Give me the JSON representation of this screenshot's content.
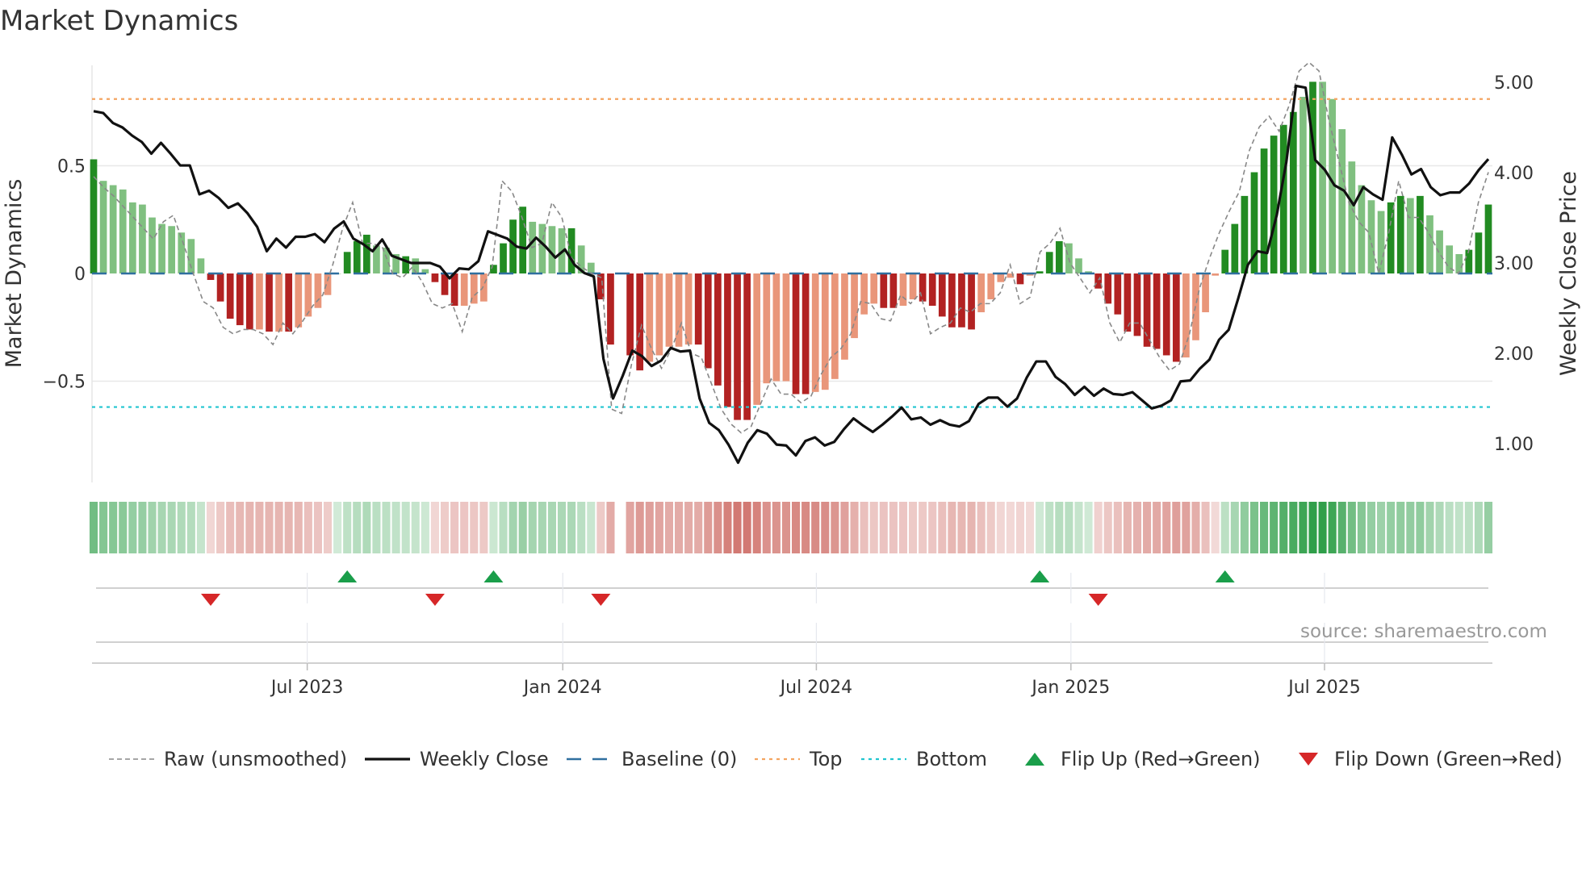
{
  "title": "Market Dynamics",
  "source": "source: sharemaestro.com",
  "colors": {
    "green_strong": "#228b22",
    "green_weak": "#80c080",
    "red_strong": "#b22222",
    "red_weak": "#e9967a",
    "close": "#111111",
    "raw": "#888888",
    "baseline": "#2f6f9f",
    "top": "#f4a460",
    "bottom": "#20c5d0",
    "flip_up": "#1a9e4a",
    "flip_down": "#d62728",
    "heat_green": "#2e9e48",
    "heat_red": "#c85a52"
  },
  "legend": [
    {
      "key": "raw",
      "label": "Raw (unsmoothed)"
    },
    {
      "key": "close",
      "label": "Weekly Close"
    },
    {
      "key": "baseline",
      "label": "Baseline (0)"
    },
    {
      "key": "top",
      "label": "Top"
    },
    {
      "key": "bottom",
      "label": "Bottom"
    },
    {
      "key": "flip_up",
      "label": "Flip Up (Red→Green)"
    },
    {
      "key": "flip_down",
      "label": "Flip Down (Green→Red)"
    }
  ],
  "chart_data": {
    "type": "bar",
    "title": "Market Dynamics",
    "ylabel": "Market Dynamics",
    "ylabel_right": "Weekly Close Price",
    "ylim": [
      -1.0,
      0.98
    ],
    "ylim_right": [
      0.35,
      5.55
    ],
    "yticks": [
      {
        "v": 0.5,
        "label": "0.5"
      },
      {
        "v": 0,
        "label": "0"
      },
      {
        "v": -0.5,
        "label": "−0.5"
      }
    ],
    "yticks_right": [
      {
        "v": 5,
        "label": "5.00"
      },
      {
        "v": 4,
        "label": "4.00"
      },
      {
        "v": 3,
        "label": "3.00"
      },
      {
        "v": 2,
        "label": "2.00"
      },
      {
        "v": 1,
        "label": "1.00"
      }
    ],
    "xticks": [
      {
        "week": 21.9,
        "label": "Jul 2023"
      },
      {
        "week": 48.1,
        "label": "Jan 2024"
      },
      {
        "week": 74.1,
        "label": "Jul 2024"
      },
      {
        "week": 100.2,
        "label": "Jan 2025"
      },
      {
        "week": 126.2,
        "label": "Jul 2025"
      }
    ],
    "top_level": 0.81,
    "bottom_level": -0.62,
    "baseline": 0,
    "values": [
      0.53,
      0.43,
      0.41,
      0.39,
      0.33,
      0.32,
      0.26,
      0.23,
      0.22,
      0.19,
      0.16,
      0.07,
      -0.03,
      -0.13,
      -0.21,
      -0.24,
      -0.26,
      -0.26,
      -0.27,
      -0.27,
      -0.27,
      -0.25,
      -0.2,
      -0.16,
      -0.1,
      0.0,
      0.1,
      0.15,
      0.18,
      0.13,
      0.12,
      0.09,
      0.08,
      0.07,
      0.02,
      -0.04,
      -0.1,
      -0.15,
      -0.15,
      -0.14,
      -0.13,
      0.04,
      0.14,
      0.25,
      0.31,
      0.24,
      0.23,
      0.22,
      0.21,
      0.21,
      0.13,
      0.05,
      -0.12,
      -0.33,
      null,
      -0.38,
      -0.45,
      -0.41,
      -0.38,
      -0.34,
      -0.34,
      -0.33,
      -0.33,
      -0.44,
      -0.52,
      -0.62,
      -0.68,
      -0.68,
      -0.61,
      -0.51,
      -0.5,
      -0.5,
      -0.56,
      -0.56,
      -0.55,
      -0.54,
      -0.49,
      -0.4,
      -0.3,
      -0.19,
      -0.14,
      -0.16,
      -0.16,
      -0.15,
      -0.12,
      -0.13,
      -0.15,
      -0.2,
      -0.25,
      -0.25,
      -0.26,
      -0.18,
      -0.12,
      -0.04,
      -0.02,
      -0.05,
      -0.01,
      0.01,
      0.1,
      0.15,
      0.14,
      0.07,
      0.01,
      -0.07,
      -0.14,
      -0.19,
      -0.27,
      -0.29,
      -0.34,
      -0.35,
      -0.38,
      -0.41,
      -0.39,
      -0.31,
      -0.18,
      -0.01,
      0.11,
      0.23,
      0.36,
      0.47,
      0.58,
      0.64,
      0.69,
      0.75,
      0.82,
      0.89,
      0.89,
      0.81,
      0.67,
      0.52,
      0.41,
      0.34,
      0.29,
      0.33,
      0.36,
      0.35,
      0.36,
      0.27,
      0.2,
      0.13,
      0.09,
      0.11,
      0.19,
      0.32
    ],
    "strength": [
      "d",
      "l",
      "l",
      "l",
      "l",
      "l",
      "l",
      "l",
      "l",
      "l",
      "l",
      "l",
      "d",
      "d",
      "d",
      "d",
      "d",
      "l",
      "d",
      "l",
      "d",
      "l",
      "l",
      "l",
      "l",
      "l",
      "d",
      "d",
      "d",
      "l",
      "l",
      "l",
      "d",
      "l",
      "l",
      "d",
      "d",
      "d",
      "l",
      "l",
      "l",
      "d",
      "d",
      "d",
      "d",
      "l",
      "l",
      "l",
      "l",
      "d",
      "l",
      "l",
      "d",
      "d",
      "l",
      "d",
      "d",
      "l",
      "l",
      "l",
      "l",
      "l",
      "d",
      "d",
      "d",
      "d",
      "d",
      "d",
      "l",
      "l",
      "l",
      "l",
      "d",
      "d",
      "l",
      "l",
      "l",
      "l",
      "l",
      "l",
      "l",
      "d",
      "d",
      "l",
      "l",
      "d",
      "d",
      "d",
      "d",
      "d",
      "d",
      "l",
      "l",
      "l",
      "l",
      "d",
      "l",
      "d",
      "d",
      "d",
      "l",
      "l",
      "l",
      "d",
      "d",
      "d",
      "d",
      "d",
      "d",
      "d",
      "d",
      "d",
      "l",
      "l",
      "l",
      "l",
      "d",
      "d",
      "d",
      "d",
      "d",
      "d",
      "d",
      "d",
      "l",
      "d",
      "l",
      "l",
      "l",
      "l",
      "l",
      "l",
      "l",
      "d",
      "d",
      "l",
      "d",
      "l",
      "l",
      "l",
      "l",
      "d",
      "d",
      "d"
    ],
    "raw": [
      0.45,
      0.4,
      0.36,
      0.31,
      0.26,
      0.21,
      0.16,
      0.24,
      0.27,
      0.14,
      0.0,
      -0.13,
      -0.16,
      -0.25,
      -0.28,
      -0.26,
      -0.26,
      -0.28,
      -0.33,
      -0.23,
      -0.28,
      -0.22,
      -0.15,
      -0.1,
      0.04,
      0.21,
      0.33,
      0.14,
      0.14,
      0.12,
      0.0,
      -0.02,
      0.03,
      -0.04,
      -0.14,
      -0.16,
      -0.14,
      -0.27,
      -0.11,
      -0.07,
      0.03,
      0.43,
      0.38,
      0.26,
      0.12,
      0.14,
      0.33,
      0.26,
      0.07,
      0.03,
      0.0,
      -0.02,
      -0.63,
      -0.65,
      -0.42,
      -0.24,
      -0.35,
      -0.44,
      -0.35,
      -0.23,
      -0.37,
      -0.39,
      -0.51,
      -0.63,
      -0.7,
      -0.74,
      -0.71,
      -0.6,
      -0.49,
      -0.56,
      -0.56,
      -0.6,
      -0.57,
      -0.47,
      -0.39,
      -0.35,
      -0.28,
      -0.13,
      -0.14,
      -0.21,
      -0.22,
      -0.1,
      -0.14,
      -0.09,
      -0.28,
      -0.25,
      -0.23,
      -0.16,
      -0.18,
      -0.14,
      -0.14,
      -0.09,
      0.04,
      -0.14,
      -0.11,
      0.1,
      0.14,
      0.21,
      0.05,
      -0.02,
      -0.09,
      -0.02,
      -0.23,
      -0.32,
      -0.23,
      -0.23,
      -0.31,
      -0.39,
      -0.45,
      -0.42,
      -0.28,
      -0.07,
      0.07,
      0.19,
      0.29,
      0.38,
      0.57,
      0.68,
      0.73,
      0.66,
      0.78,
      0.94,
      0.98,
      0.94,
      0.71,
      0.52,
      0.33,
      0.24,
      0.19,
      0.0,
      0.19,
      0.43,
      0.26,
      0.26,
      0.19,
      0.1,
      0.03,
      0.0,
      0.1,
      0.33,
      0.47
    ],
    "close": [
      4.68,
      4.66,
      4.55,
      4.5,
      4.41,
      4.34,
      4.21,
      4.33,
      4.21,
      4.08,
      4.08,
      3.76,
      3.8,
      3.72,
      3.61,
      3.66,
      3.55,
      3.4,
      3.13,
      3.27,
      3.17,
      3.29,
      3.29,
      3.32,
      3.23,
      3.38,
      3.46,
      3.27,
      3.21,
      3.13,
      3.26,
      3.08,
      3.04,
      3.0,
      3.0,
      3.0,
      2.96,
      2.83,
      2.94,
      2.93,
      3.02,
      3.35,
      3.31,
      3.27,
      3.18,
      3.16,
      3.28,
      3.18,
      3.06,
      3.15,
      2.98,
      2.89,
      2.85,
      1.94,
      1.5,
      1.75,
      2.03,
      1.97,
      1.86,
      1.92,
      2.06,
      2.02,
      2.03,
      1.5,
      1.23,
      1.15,
      0.99,
      0.79,
      1.01,
      1.15,
      1.11,
      0.99,
      0.98,
      0.87,
      1.03,
      1.07,
      0.98,
      1.02,
      1.16,
      1.28,
      1.2,
      1.13,
      1.21,
      1.3,
      1.4,
      1.27,
      1.29,
      1.21,
      1.26,
      1.21,
      1.19,
      1.25,
      1.44,
      1.51,
      1.51,
      1.41,
      1.5,
      1.73,
      1.91,
      1.91,
      1.74,
      1.66,
      1.54,
      1.63,
      1.53,
      1.61,
      1.55,
      1.54,
      1.57,
      1.48,
      1.39,
      1.42,
      1.48,
      1.69,
      1.7,
      1.83,
      1.93,
      2.15,
      2.26,
      2.61,
      2.98,
      3.13,
      3.11,
      3.53,
      4.12,
      4.96,
      4.94,
      4.14,
      4.03,
      3.86,
      3.8,
      3.64,
      3.84,
      3.76,
      3.7,
      4.39,
      4.2,
      3.98,
      4.04,
      3.84,
      3.75,
      3.78,
      3.78,
      3.88,
      4.03,
      4.15
    ],
    "flips": [
      {
        "week": 12,
        "type": "down"
      },
      {
        "week": 26,
        "type": "up"
      },
      {
        "week": 35,
        "type": "down"
      },
      {
        "week": 41,
        "type": "up"
      },
      {
        "week": 52,
        "type": "down"
      },
      {
        "week": 97,
        "type": "up"
      },
      {
        "week": 103,
        "type": "down"
      },
      {
        "week": 116,
        "type": "up"
      }
    ],
    "legend_position": "bottom"
  }
}
